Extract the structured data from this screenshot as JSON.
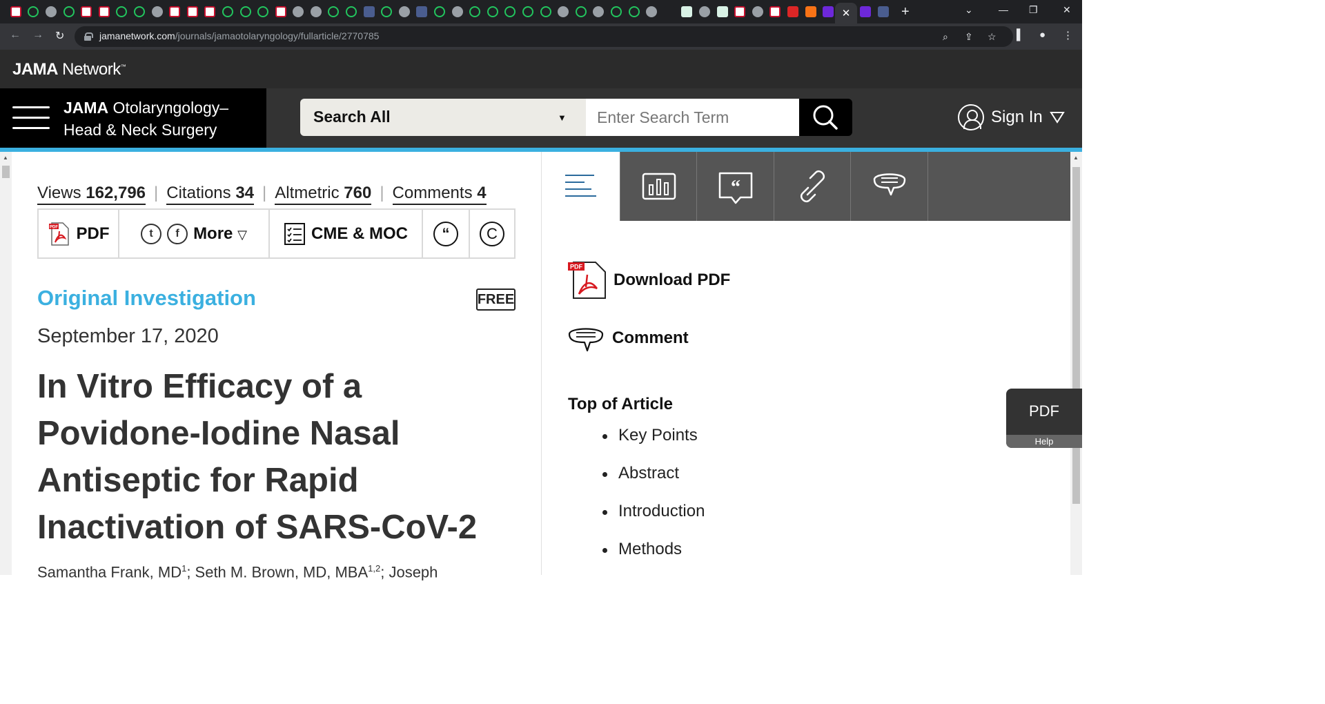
{
  "browser": {
    "url_domain": "jamanetwork.com",
    "url_path": "/journals/jamaotolaryngology/fullarticle/2770785",
    "active_tab_close": "✕",
    "new_tab": "+"
  },
  "network": {
    "logo_bold": "JAMA",
    "logo_rest": " Network",
    "logo_mark": "™"
  },
  "header": {
    "journal_bold": "JAMA",
    "journal_line1_rest": " Otolaryngology–",
    "journal_line2": "Head & Neck Surgery",
    "search_scope": "Search All",
    "search_placeholder": "Enter Search Term",
    "sign_in": "Sign In"
  },
  "metrics": [
    {
      "label": "Views",
      "value": "162,796"
    },
    {
      "label": "Citations",
      "value": "34"
    },
    {
      "label": "Altmetric",
      "value": "760"
    },
    {
      "label": "Comments",
      "value": "4"
    }
  ],
  "toolbar": {
    "pdf_label": "PDF",
    "pdf_tag": "PDF",
    "twitter_glyph": "t",
    "facebook_glyph": "f",
    "more_label": "More",
    "cme_label": "CME & MOC",
    "cite_glyph": "“",
    "permissions_glyph": "C"
  },
  "article": {
    "type": "Original Investigation",
    "free_badge": "FREE",
    "date": "September 17, 2020",
    "title": "In Vitro Efficacy of a Povidone-Iodine Nasal Antiseptic for Rapid Inactivation of SARS-CoV-2",
    "author1": "Samantha Frank, MD",
    "author1_sup": "1",
    "author2": "; Seth M. Brown, MD, MBA",
    "author2_sup": "1,2",
    "author3": "; Joseph"
  },
  "right_panel": {
    "download_pdf": "Download PDF",
    "pdf_icon_tag": "PDF",
    "comment": "Comment",
    "toc_title": "Top of Article",
    "toc_items": [
      "Key Points",
      "Abstract",
      "Introduction",
      "Methods"
    ]
  },
  "pdf_widget": {
    "label": "PDF",
    "help": "Help"
  },
  "colors": {
    "accent_blue": "#3bb0e0",
    "header_black": "#000000",
    "tab_dark": "#555555"
  }
}
